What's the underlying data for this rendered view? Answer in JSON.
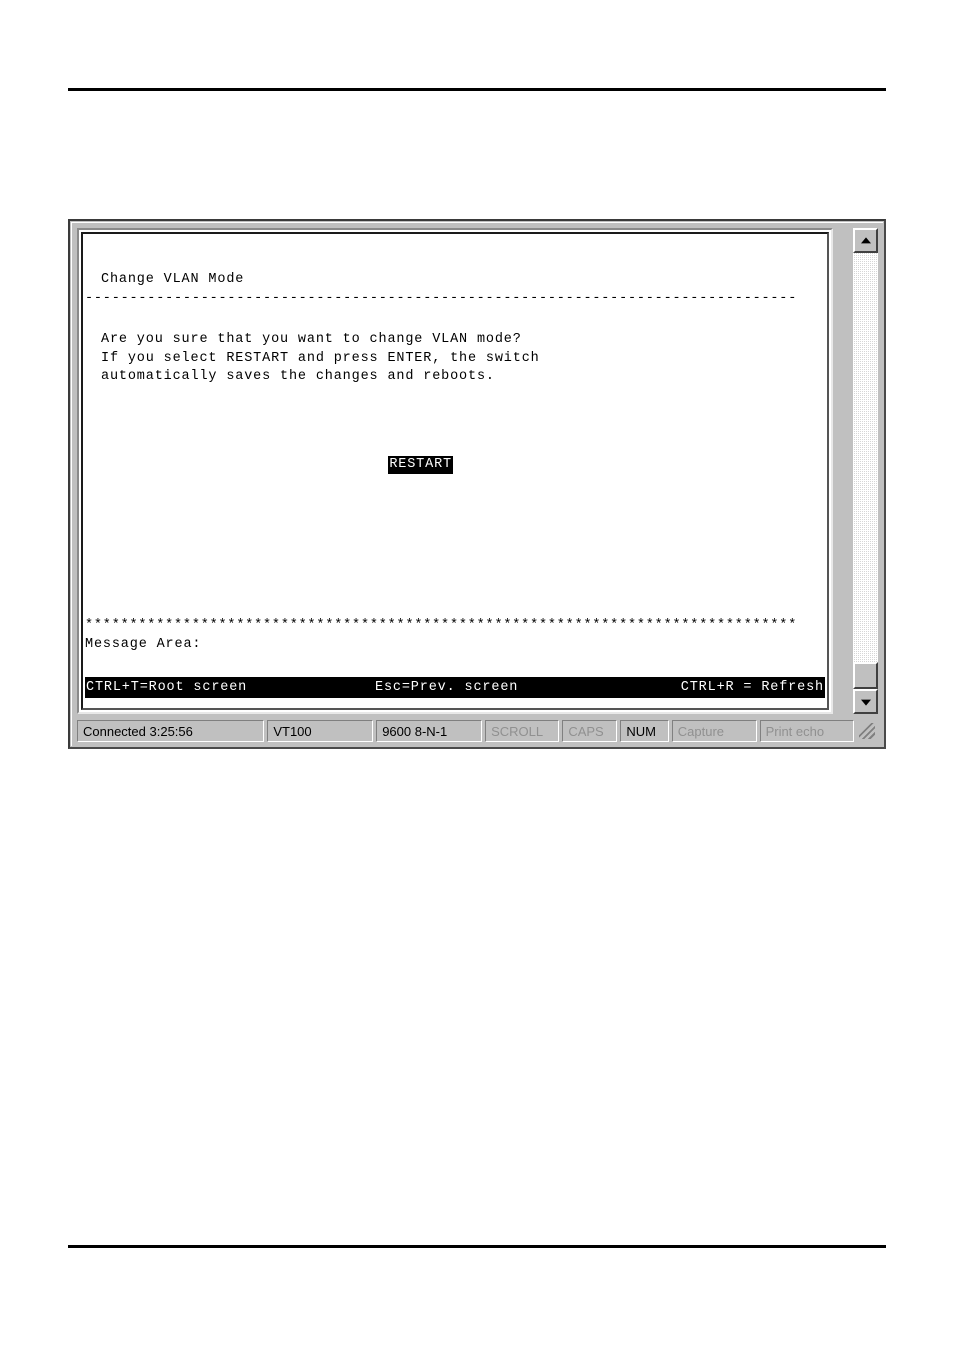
{
  "document": {
    "top_rule": true,
    "bottom_rule": true
  },
  "terminal": {
    "title": "Change VLAN Mode",
    "separator": "--------------------------------------------------------------------------------",
    "body": [
      "Are you sure that you want to change VLAN mode?",
      "If you select RESTART and press ENTER, the switch",
      "automatically saves the changes and reboots."
    ],
    "selected_action": "RESTART",
    "stars": "********************************************************************************",
    "message_area_label": "Message Area:",
    "message_area_value": "",
    "command_bar": {
      "left": "CTRL+T=Root screen",
      "center": "Esc=Prev. screen",
      "right": "CTRL+R = Refresh"
    },
    "colors": {
      "background": "#ffffff",
      "foreground": "#000000",
      "inverse_background": "#000000",
      "inverse_foreground": "#ffffff",
      "window_face": "#c0c0c0"
    }
  },
  "scrollbar": {
    "up_arrow": "▲",
    "down_arrow": "▼",
    "thumb_position": "bottom"
  },
  "statusbar": {
    "connected": "Connected 3:25:56",
    "emulation": "VT100",
    "line_settings": "9600 8-N-1",
    "scroll": "SCROLL",
    "caps": "CAPS",
    "num": "NUM",
    "capture": "Capture",
    "print_echo": "Print echo",
    "resize_grip": "resize-grip"
  }
}
